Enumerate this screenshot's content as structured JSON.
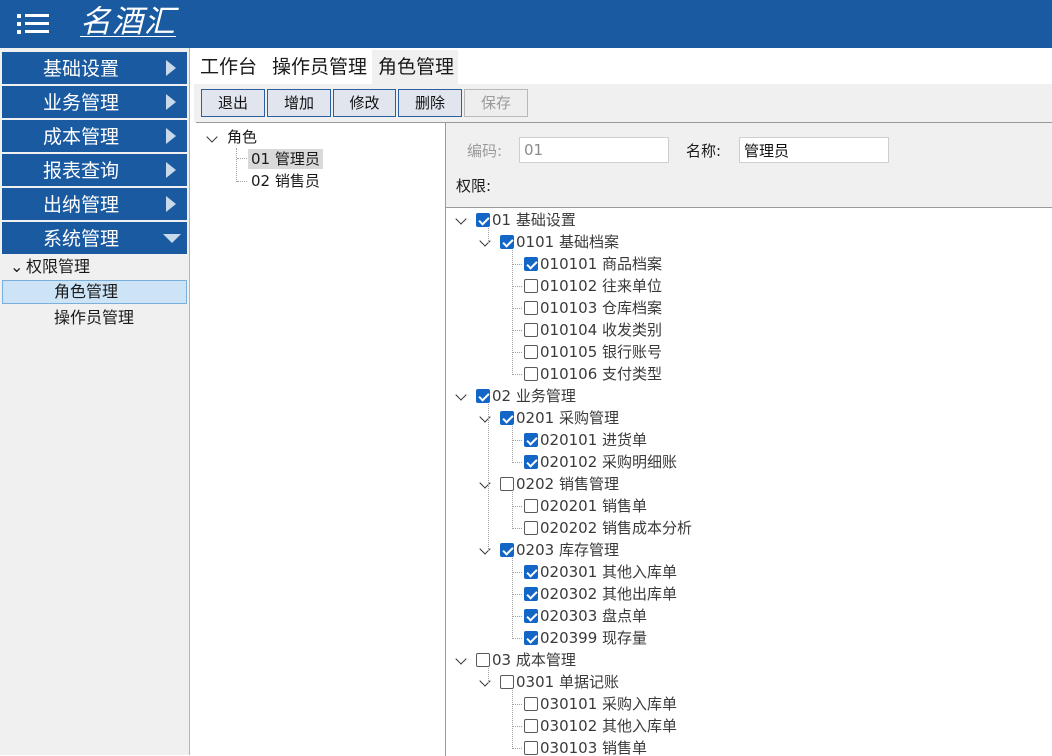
{
  "app": {
    "logo": "名酒汇"
  },
  "sidebar": {
    "sections": [
      {
        "label": "基础设置",
        "expanded": false
      },
      {
        "label": "业务管理",
        "expanded": false
      },
      {
        "label": "成本管理",
        "expanded": false
      },
      {
        "label": "报表查询",
        "expanded": false
      },
      {
        "label": "出纳管理",
        "expanded": false
      },
      {
        "label": "系统管理",
        "expanded": true
      }
    ],
    "group": "权限管理",
    "sub_items": [
      {
        "label": "角色管理",
        "selected": true
      },
      {
        "label": "操作员管理",
        "selected": false
      }
    ]
  },
  "tabs": [
    {
      "label": "工作台",
      "active": false
    },
    {
      "label": "操作员管理",
      "active": false
    },
    {
      "label": "角色管理",
      "active": true
    }
  ],
  "toolbar": {
    "exit": "退出",
    "add": "增加",
    "edit": "修改",
    "delete": "删除",
    "save": "保存"
  },
  "role_tree": {
    "root": "角色",
    "roles": [
      {
        "label": "01 管理员",
        "selected": true
      },
      {
        "label": "02 销售员",
        "selected": false
      }
    ]
  },
  "detail": {
    "code_label": "编码:",
    "code_value": "01",
    "name_label": "名称:",
    "name_value": "管理员",
    "perm_label": "权限:"
  },
  "permissions": [
    {
      "label": "01 基础设置",
      "level": 0,
      "checked": true,
      "expanded": true
    },
    {
      "label": "0101 基础档案",
      "level": 1,
      "checked": true,
      "expanded": true
    },
    {
      "label": "010101 商品档案",
      "level": 2,
      "checked": true
    },
    {
      "label": "010102 往来单位",
      "level": 2,
      "checked": false
    },
    {
      "label": "010103 仓库档案",
      "level": 2,
      "checked": false
    },
    {
      "label": "010104 收发类别",
      "level": 2,
      "checked": false
    },
    {
      "label": "010105 银行账号",
      "level": 2,
      "checked": false
    },
    {
      "label": "010106 支付类型",
      "level": 2,
      "checked": false
    },
    {
      "label": "02 业务管理",
      "level": 0,
      "checked": true,
      "expanded": true
    },
    {
      "label": "0201 采购管理",
      "level": 1,
      "checked": true,
      "expanded": true
    },
    {
      "label": "020101 进货单",
      "level": 2,
      "checked": true
    },
    {
      "label": "020102 采购明细账",
      "level": 2,
      "checked": true
    },
    {
      "label": "0202 销售管理",
      "level": 1,
      "checked": false,
      "expanded": true
    },
    {
      "label": "020201 销售单",
      "level": 2,
      "checked": false
    },
    {
      "label": "020202 销售成本分析",
      "level": 2,
      "checked": false
    },
    {
      "label": "0203 库存管理",
      "level": 1,
      "checked": true,
      "expanded": true
    },
    {
      "label": "020301 其他入库单",
      "level": 2,
      "checked": true
    },
    {
      "label": "020302 其他出库单",
      "level": 2,
      "checked": true
    },
    {
      "label": "020303 盘点单",
      "level": 2,
      "checked": true
    },
    {
      "label": "020399 现存量",
      "level": 2,
      "checked": true
    },
    {
      "label": "03 成本管理",
      "level": 0,
      "checked": false,
      "expanded": true
    },
    {
      "label": "0301 单据记账",
      "level": 1,
      "checked": false,
      "expanded": true
    },
    {
      "label": "030101 采购入库单",
      "level": 2,
      "checked": false
    },
    {
      "label": "030102 其他入库单",
      "level": 2,
      "checked": false
    },
    {
      "label": "030103 销售单",
      "level": 2,
      "checked": false
    }
  ]
}
